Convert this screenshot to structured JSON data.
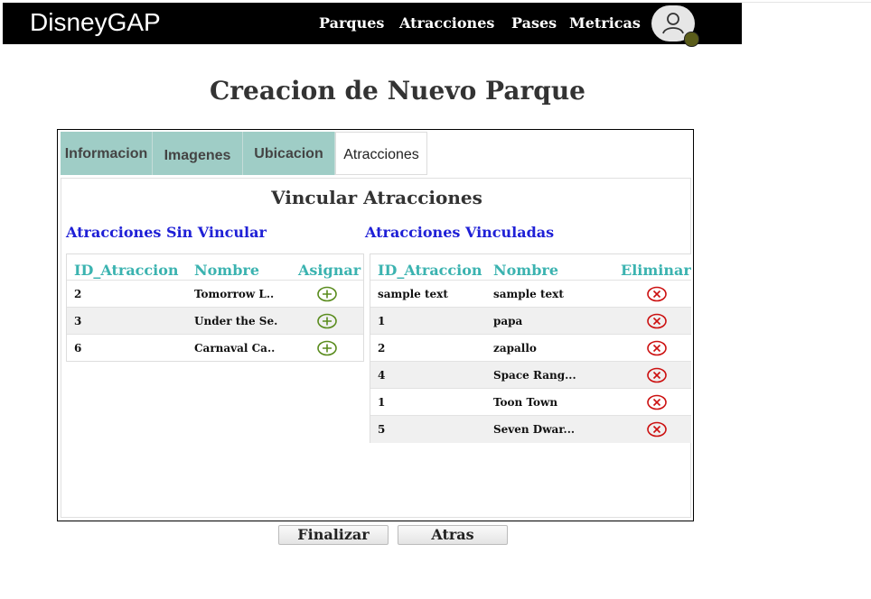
{
  "app": {
    "brand": "DisneyGAP"
  },
  "nav": [
    "Parques",
    "Atracciones",
    "Pases",
    "Metricas"
  ],
  "page": {
    "title": "Creacion de Nuevo Parque"
  },
  "tabs": [
    "Informacion",
    "Imagenes",
    "Ubicacion",
    "Atracciones"
  ],
  "active_tab": "Atracciones",
  "section": {
    "title": "Vincular Atracciones",
    "unlinked_title": "Atracciones Sin Vincular",
    "linked_title": "Atracciones Vinculadas"
  },
  "unlinked": {
    "headers": [
      "ID_Atraccion",
      "Nombre",
      "Asignar"
    ],
    "rows": [
      {
        "id": "2",
        "name": "Tomorrow L.."
      },
      {
        "id": "3",
        "name": "Under the Se.."
      },
      {
        "id": "6",
        "name": "Carnaval Ca.."
      }
    ]
  },
  "linked": {
    "headers": [
      "ID_Atraccion",
      "Nombre",
      "Eliminar"
    ],
    "rows": [
      {
        "id": "sample text",
        "name": "sample text"
      },
      {
        "id": "1",
        "name": "papa"
      },
      {
        "id": "2",
        "name": "zapallo"
      },
      {
        "id": "4",
        "name": "Space Rang..."
      },
      {
        "id": "1",
        "name": "Toon Town"
      },
      {
        "id": "5",
        "name": "Seven Dwar..."
      }
    ]
  },
  "buttons": {
    "finish": "Finalizar",
    "back": "Atras"
  },
  "colors": {
    "navbar": "#000000",
    "tab": "#9fcdc6",
    "subtitle": "#1f20d6",
    "header": "#3bb3b0",
    "add": "#5a8c1e",
    "delete": "#cc1111"
  },
  "icons": {
    "assign": "plus-circle-icon",
    "delete": "x-circle-icon",
    "avatar": "user-icon"
  }
}
